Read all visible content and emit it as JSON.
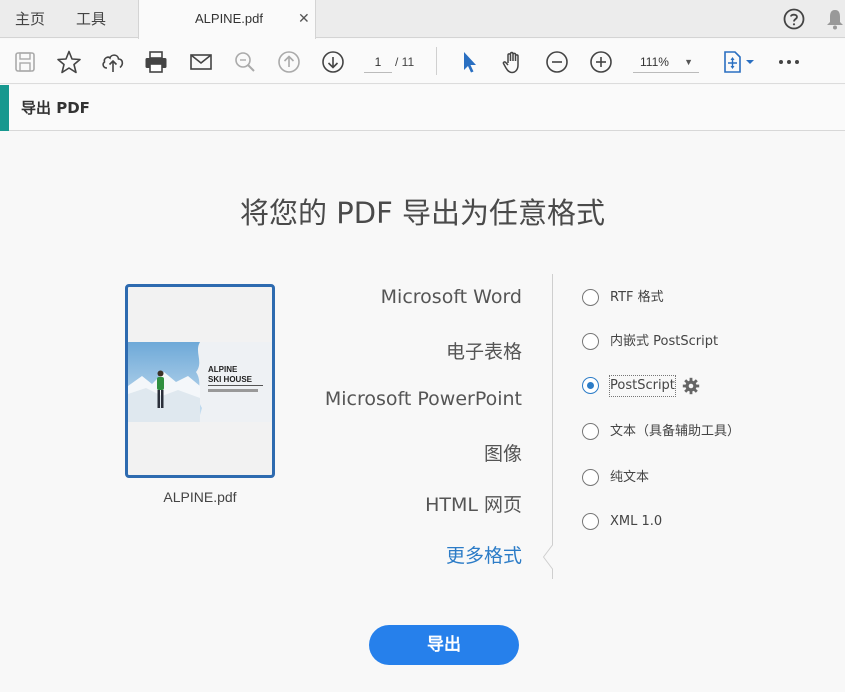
{
  "tabs": {
    "home": "主页",
    "tools": "工具",
    "document": "ALPINE.pdf",
    "close": "✕"
  },
  "toolbar": {
    "page_current": "1",
    "page_total": "/ 11",
    "zoom": "111%"
  },
  "section": {
    "title": "导出 PDF"
  },
  "main": {
    "title": "将您的 PDF 导出为任意格式"
  },
  "thumbnail": {
    "filename": "ALPINE.pdf",
    "brand_line1": "ALPINE",
    "brand_line2": "SKI HOUSE"
  },
  "formats": [
    "Microsoft Word",
    "电子表格",
    "Microsoft PowerPoint",
    "图像",
    "HTML 网页",
    "更多格式"
  ],
  "options": [
    "RTF 格式",
    "内嵌式 PostScript",
    "PostScript",
    "文本（具备辅助工具）",
    "纯文本",
    "XML 1.0"
  ],
  "selected_format": "更多格式",
  "selected_option": "PostScript",
  "export_button": "导出",
  "colors": {
    "accent": "#2680eb",
    "section_accent": "#17988f",
    "active_link": "#2c7cc7"
  },
  "icons": [
    "save-icon",
    "star-icon",
    "upload-icon",
    "print-icon",
    "mail-icon",
    "zoom-search-icon",
    "prev-page-icon",
    "next-page-icon",
    "cursor-icon",
    "hand-icon",
    "zoom-out-icon",
    "zoom-in-icon",
    "fit-page-icon",
    "more-icon",
    "help-icon",
    "bell-icon",
    "gear-icon"
  ]
}
